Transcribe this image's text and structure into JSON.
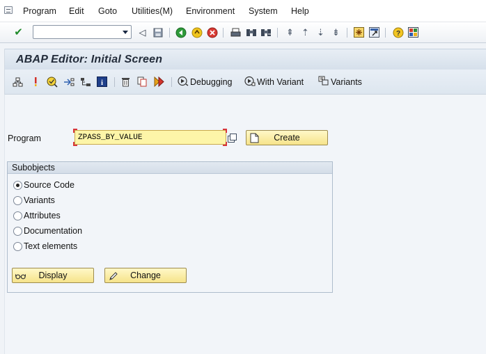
{
  "menubar": {
    "items": [
      "Program",
      "Edit",
      "Goto",
      "Utilities(M)",
      "Environment",
      "System",
      "Help"
    ]
  },
  "toolbar": {
    "command_field_value": "",
    "icons": [
      "enter-check-icon",
      "back-arrow-icon",
      "save-icon",
      "back-green-icon",
      "exit-icon",
      "cancel-icon",
      "print-icon",
      "find-icon",
      "find-next-icon",
      "first-page-icon",
      "previous-page-icon",
      "next-page-icon",
      "last-page-icon",
      "new-session-icon",
      "shortcut-icon",
      "help-icon",
      "customize-layout-icon"
    ]
  },
  "title": {
    "text": "ABAP Editor: Initial Screen"
  },
  "app_toolbar": {
    "icons": [
      "hierarchy-icon",
      "where-used-icon",
      "check-icon",
      "activate-icon",
      "test-icon",
      "info-icon",
      "delete-icon",
      "copy-icon",
      "execute-icon"
    ],
    "debugging_label": "Debugging",
    "with_variant_label": "With Variant",
    "variants_label": "Variants"
  },
  "form": {
    "program_label": "Program",
    "program_value": "ZPASS_BY_VALUE",
    "create_label": "Create"
  },
  "subobjects": {
    "title": "Subobjects",
    "options": [
      {
        "label": "Source Code",
        "selected": true
      },
      {
        "label": "Variants",
        "selected": false
      },
      {
        "label": "Attributes",
        "selected": false
      },
      {
        "label": "Documentation",
        "selected": false
      },
      {
        "label": "Text elements",
        "selected": false
      }
    ],
    "display_label": "Display",
    "change_label": "Change"
  },
  "colors": {
    "input_bg": "#fdf5a8",
    "button_bg": "#f6e38a",
    "title_bg": "#d6e0eb",
    "required_marker": "#d8353b"
  }
}
